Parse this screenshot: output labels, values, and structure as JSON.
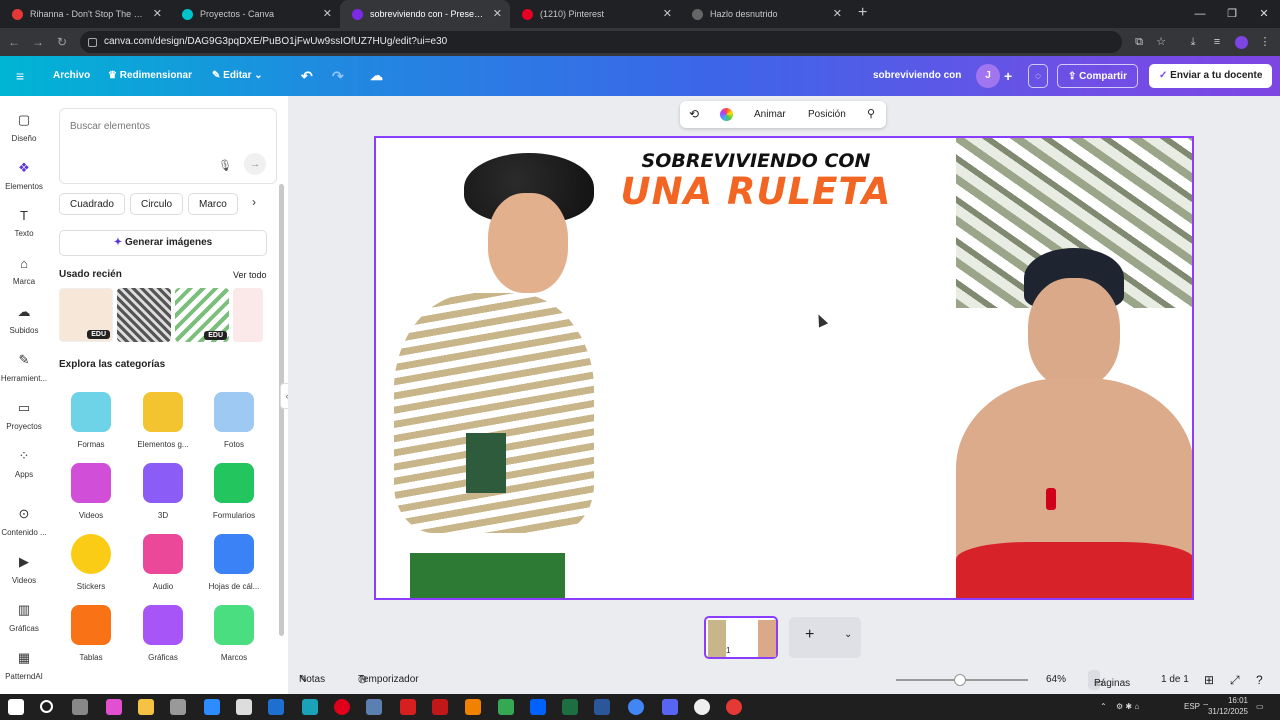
{
  "browser": {
    "tabs": [
      {
        "label": "Rihanna - Don't Stop The Music",
        "color": "#e53935"
      },
      {
        "label": "Proyectos - Canva",
        "color": "#00c4cc"
      },
      {
        "label": "sobreviviendo con - Presentación",
        "color": "#7d2ae8"
      },
      {
        "label": "(1210) Pinterest",
        "color": "#e60023"
      },
      {
        "label": "Hazlo desnutrido",
        "color": "#555555"
      }
    ],
    "url": "canva.com/design/DAG9G3pqDXE/PuBO1jFwUw9ssIOfUZ7HUg/edit?ui=e30"
  },
  "toolbar": {
    "archivo": "Archivo",
    "redimensionar": "Redimensionar",
    "editar": "Editar",
    "doc_title": "sobreviviendo con",
    "avatar_initial": "J",
    "share": "Compartir",
    "send": "Enviar a tu docente"
  },
  "rail": [
    {
      "label": "Diseño",
      "icon": "layout-icon"
    },
    {
      "label": "Elementos",
      "icon": "elements-icon"
    },
    {
      "label": "Texto",
      "icon": "text-icon"
    },
    {
      "label": "Marca",
      "icon": "brand-icon"
    },
    {
      "label": "Subidos",
      "icon": "upload-icon"
    },
    {
      "label": "Herramient...",
      "icon": "tools-icon"
    },
    {
      "label": "Proyectos",
      "icon": "folder-icon"
    },
    {
      "label": "Apps",
      "icon": "apps-icon"
    },
    {
      "label": "Contenido ...",
      "icon": "content-icon"
    },
    {
      "label": "Videos",
      "icon": "video-icon"
    },
    {
      "label": "Gráficas",
      "icon": "chart-icon"
    },
    {
      "label": "PatterndAI",
      "icon": "pattern-icon"
    }
  ],
  "panel": {
    "search_placeholder": "Buscar elementos",
    "chips": [
      "Cuadrado",
      "Circulo",
      "Marco"
    ],
    "generate": "Generar imágenes",
    "recent_title": "Usado recién",
    "see_all": "Ver todo",
    "edu_badge": "EDU",
    "explore_title": "Explora las categorías",
    "categories": [
      {
        "label": "Formas",
        "color": "#6fd3e8"
      },
      {
        "label": "Elementos g...",
        "color": "#f4c430"
      },
      {
        "label": "Fotos",
        "color": "#9ec9f2"
      },
      {
        "label": "Videos",
        "color": "#d04ed8"
      },
      {
        "label": "3D",
        "color": "#8b5cf6"
      },
      {
        "label": "Formularios",
        "color": "#22c55e"
      },
      {
        "label": "Stickers",
        "color": "#facc15"
      },
      {
        "label": "Audio",
        "color": "#ec4899"
      },
      {
        "label": "Hojas de cál...",
        "color": "#3b82f6"
      },
      {
        "label": "Tablas",
        "color": "#f97316"
      },
      {
        "label": "Gráficas",
        "color": "#a855f7"
      },
      {
        "label": "Marcos",
        "color": "#4ade80"
      }
    ]
  },
  "context_bar": {
    "animate": "Animar",
    "position": "Posición"
  },
  "slide": {
    "title_line1": "SOBREVIVIENDO CON",
    "title_line2": "UNA RULETA"
  },
  "bottom": {
    "notes": "Notas",
    "timer": "Temporizador",
    "zoom": "64%",
    "pages": "Páginas",
    "page_count": "1 de 1",
    "thumb_number": "1"
  },
  "taskbar": {
    "lang": "ESP",
    "time": "16:01",
    "date": "31/12/2025"
  },
  "colors": {
    "accent": "#8b3dff",
    "orange": "#f26522"
  }
}
